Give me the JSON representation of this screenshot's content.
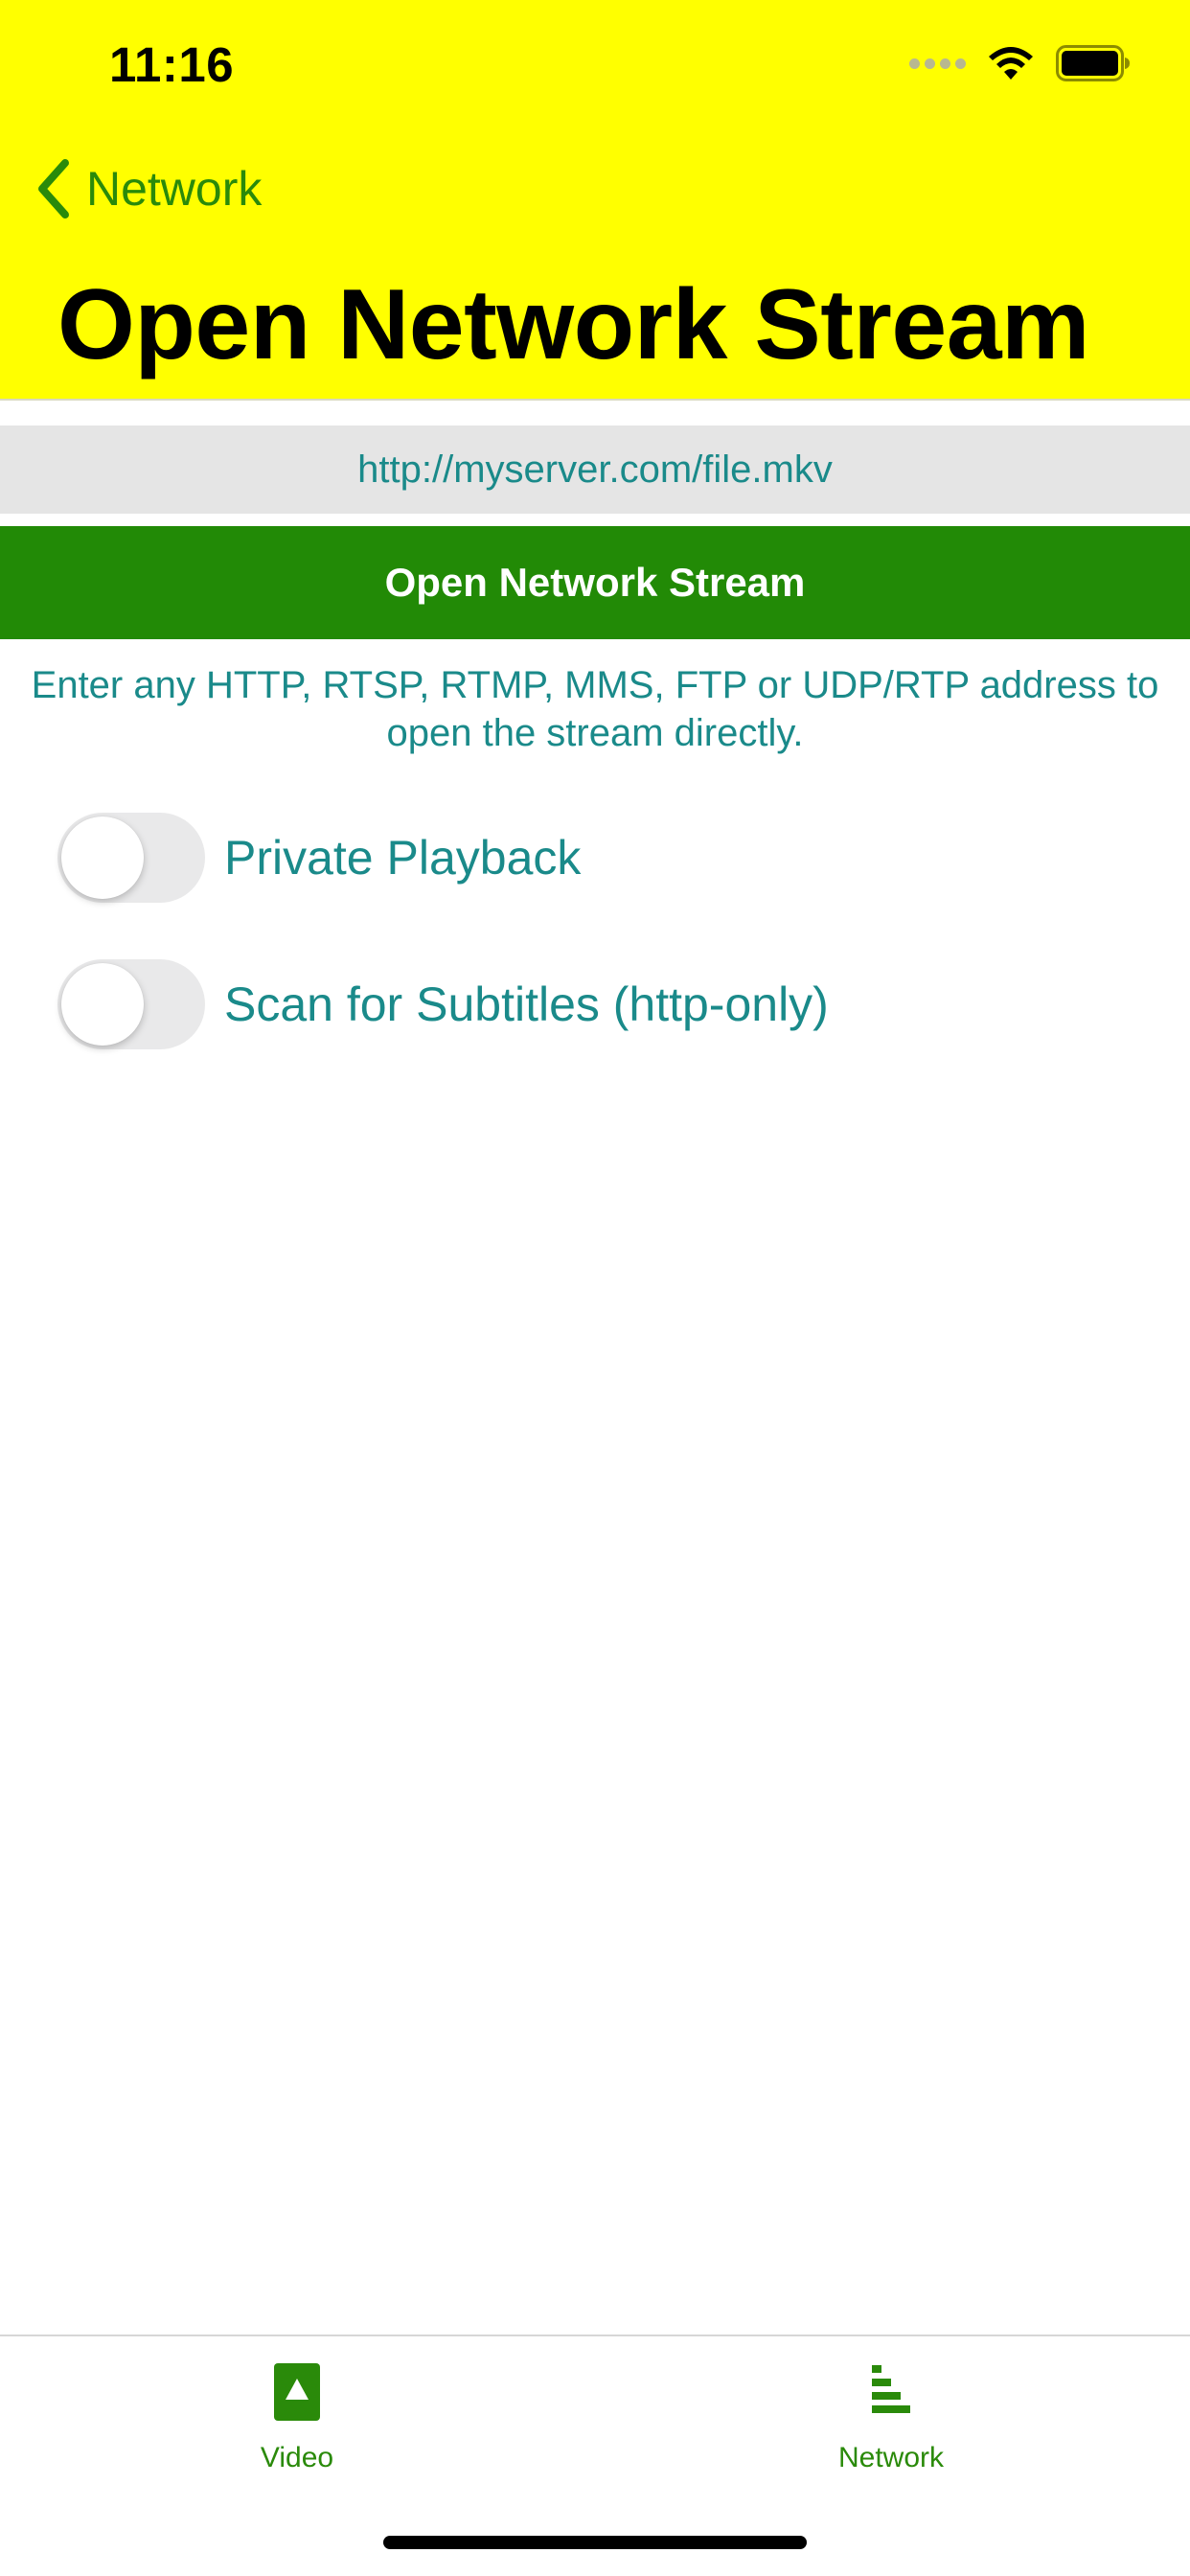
{
  "status_bar": {
    "time": "11:16",
    "icons": [
      "signal-dots-icon",
      "wifi-icon",
      "battery-icon"
    ]
  },
  "nav": {
    "back_label": "Network",
    "title": "Open Network Stream"
  },
  "url_field": {
    "placeholder": "http://myserver.com/file.mkv",
    "value": ""
  },
  "open_button": {
    "label": "Open Network Stream"
  },
  "help_text": "Enter any HTTP, RTSP, RTMP, MMS, FTP or UDP/RTP address to open the stream directly.",
  "toggles": [
    {
      "label": "Private Playback",
      "on": false
    },
    {
      "label": "Scan for Subtitles (http-only)",
      "on": false
    }
  ],
  "tab_bar": {
    "tabs": [
      {
        "label": "Video",
        "icon": "video-icon"
      },
      {
        "label": "Network",
        "icon": "network-icon"
      }
    ]
  },
  "colors": {
    "header_bg": "#ffff00",
    "accent_green": "#228a06",
    "text_teal": "#1a8a8a",
    "input_bg": "#e5e5e5"
  }
}
